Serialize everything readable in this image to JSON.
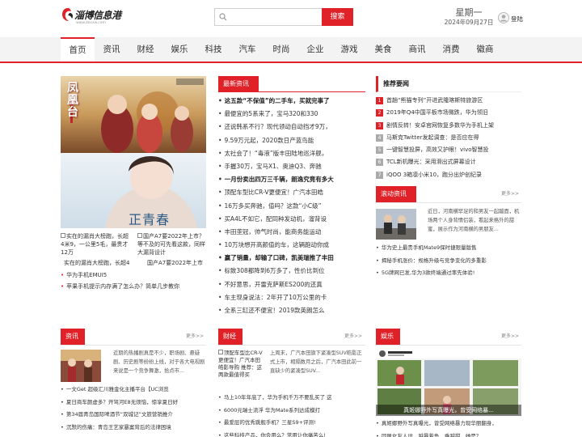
{
  "header": {
    "logo_name": "淄博信息港",
    "logo_url": "www.zbxxw.com",
    "search_button": "搜索",
    "weekday": "星期一",
    "date": "2024年09月27日",
    "login": "登陆"
  },
  "nav": [
    "首页",
    "资讯",
    "财经",
    "娱乐",
    "科技",
    "汽车",
    "时尚",
    "企业",
    "游戏",
    "美食",
    "商讯",
    "消费",
    "徽商"
  ],
  "poster": {
    "title_text": "凤凰台",
    "subtitle_text": "正青春"
  },
  "thumbs": [
    {
      "alt": "实在的漏肖大榜跑，长超4米9，一公里5毛，最贵才12万",
      "caption": "实在的漏肖大榜跑，长超4"
    },
    {
      "alt": "国产A7要2022年上市？等不及的可先看这款，同样大漏背设计",
      "caption": "国产A7要2022年上市"
    }
  ],
  "left_list": [
    "华为手机EMUI5",
    "苹果手机提示内存满了怎么办？简单几步教你"
  ],
  "latest": {
    "title": "最新资讯",
    "items": [
      {
        "text": "这五款“不保值”的二手车，买就完事了",
        "bold": true
      },
      {
        "text": "最便宜的5系来了，宝马320和330",
        "bold": false
      },
      {
        "text": "还说韩系不行？现代领动自动挡才9万，",
        "bold": false
      },
      {
        "text": "9.59万元起，2020款日产蓝鸟能",
        "bold": false
      },
      {
        "text": "太社会了！“毒液”版丰田陆地巡洋舰，",
        "bold": false
      },
      {
        "text": "手握30万，宝马X1、奥迪Q3、奔驰",
        "bold": false
      },
      {
        "text": "一月份卖出四万三千辆，朗逸究竟有多大",
        "bold": true
      },
      {
        "text": "顶配车型比CR-V更便宜！广汽本田皓",
        "bold": false
      },
      {
        "text": "16万多买奔驰，值吗？这款“小C级”",
        "bold": false
      },
      {
        "text": "买A4L不如它，配同种发动机，溜背设",
        "bold": false
      },
      {
        "text": "丰田垄冠，帅气时尚，能商务能运动",
        "bold": false
      },
      {
        "text": "10万块想开高颜值的车，这辆跑动你成",
        "bold": false
      },
      {
        "text": "赢了销量，却输了口碑，凯美瑞推了丰田",
        "bold": true
      },
      {
        "text": "标致308都降到6万多了，性价比到位",
        "bold": false
      },
      {
        "text": "不好意思，开雷克萨斯ES200的还真",
        "bold": false
      },
      {
        "text": "车主现身说法：2年开了10万公里的卡",
        "bold": false
      },
      {
        "text": "全系三缸还不便宜！2019款英朗怎么",
        "bold": false
      }
    ]
  },
  "rank": {
    "title": "推荐要闻",
    "items": [
      "首趟“熊猫专列”开进武隆喀斯特旅游区",
      "2019年Q4中国平板市场微跌，华为领旧",
      "剧情反转！安卓官网恢复多数华为手机上架",
      "马斯克Twitter发起调查：是否应在得",
      "一键智慧投屏，高效又护眼！vivo智慧投",
      "TCL新机曝光：采用滑出式屏幕设计",
      "iQOO 3箱凛小米10，跑分出炉创纪录"
    ]
  },
  "scroll": {
    "title": "滚动资讯",
    "more": "更多>>",
    "summary": "近日，河南横罕足的和男友一起蹦面，机场两个人身背情侣装，看起来格外的甜蜜，展示作为河南横的男朋友...",
    "items": [
      "华为史上最贵手机Mate9保时捷限量版售",
      "揭秘手机涨价：规格升级与竞争变化的多重影",
      "5G牌网已发,华为3款终端通过率先体验!"
    ]
  },
  "zixun": {
    "title": "资讯",
    "more": "更多>>",
    "summary": "近期的热播剧真是不少，职场剧、悬疑剧、历史剧等纷纷上线，对于各大电视剧来说是一个竞争舞激，拾点市...",
    "items": [
      "一文Get 超级汇川雅金化主播平台【UC浏览",
      "夏日商车颜虚多？开驾河E8无烦恼，惊享夏日好",
      "第34届青岛国际啤酒节“双城记”文旅营销推介",
      "沉默的伤痛：青岛王艺家暴案背后的法律困境"
    ]
  },
  "caijing": {
    "title": "财经",
    "more": "更多>>",
    "img_alt": "顶配车型比CR-V更便宜！广汽本田皓影导购 推荐：这两款最值得买",
    "summary": "上周末，广汽本田旗下紧凑型SUV皓影正式上市，相隔数月之后，广汽本田此前一直缺少的紧凑型SUV...",
    "items": [
      "马上10年年底了，华为手机千万不要乱买了 这",
      "6000元瑞士流浮 华为Mate系列达成模打",
      "最爱层的优秀跳舰手机？三星S9+评测!",
      "这些科技产品，你会用么？常用让你痛苦么!"
    ]
  },
  "yule": {
    "title": "娱乐",
    "more": "更多>>",
    "img_caption": "真姬娜野外写真曝光，曾受网络暴...",
    "items": [
      "真姬娜野外写真曝光，曾受网络暴力现华丽翻身，",
      "同居女友人设，越暴若鱼，乘越甜，她是？"
    ]
  }
}
